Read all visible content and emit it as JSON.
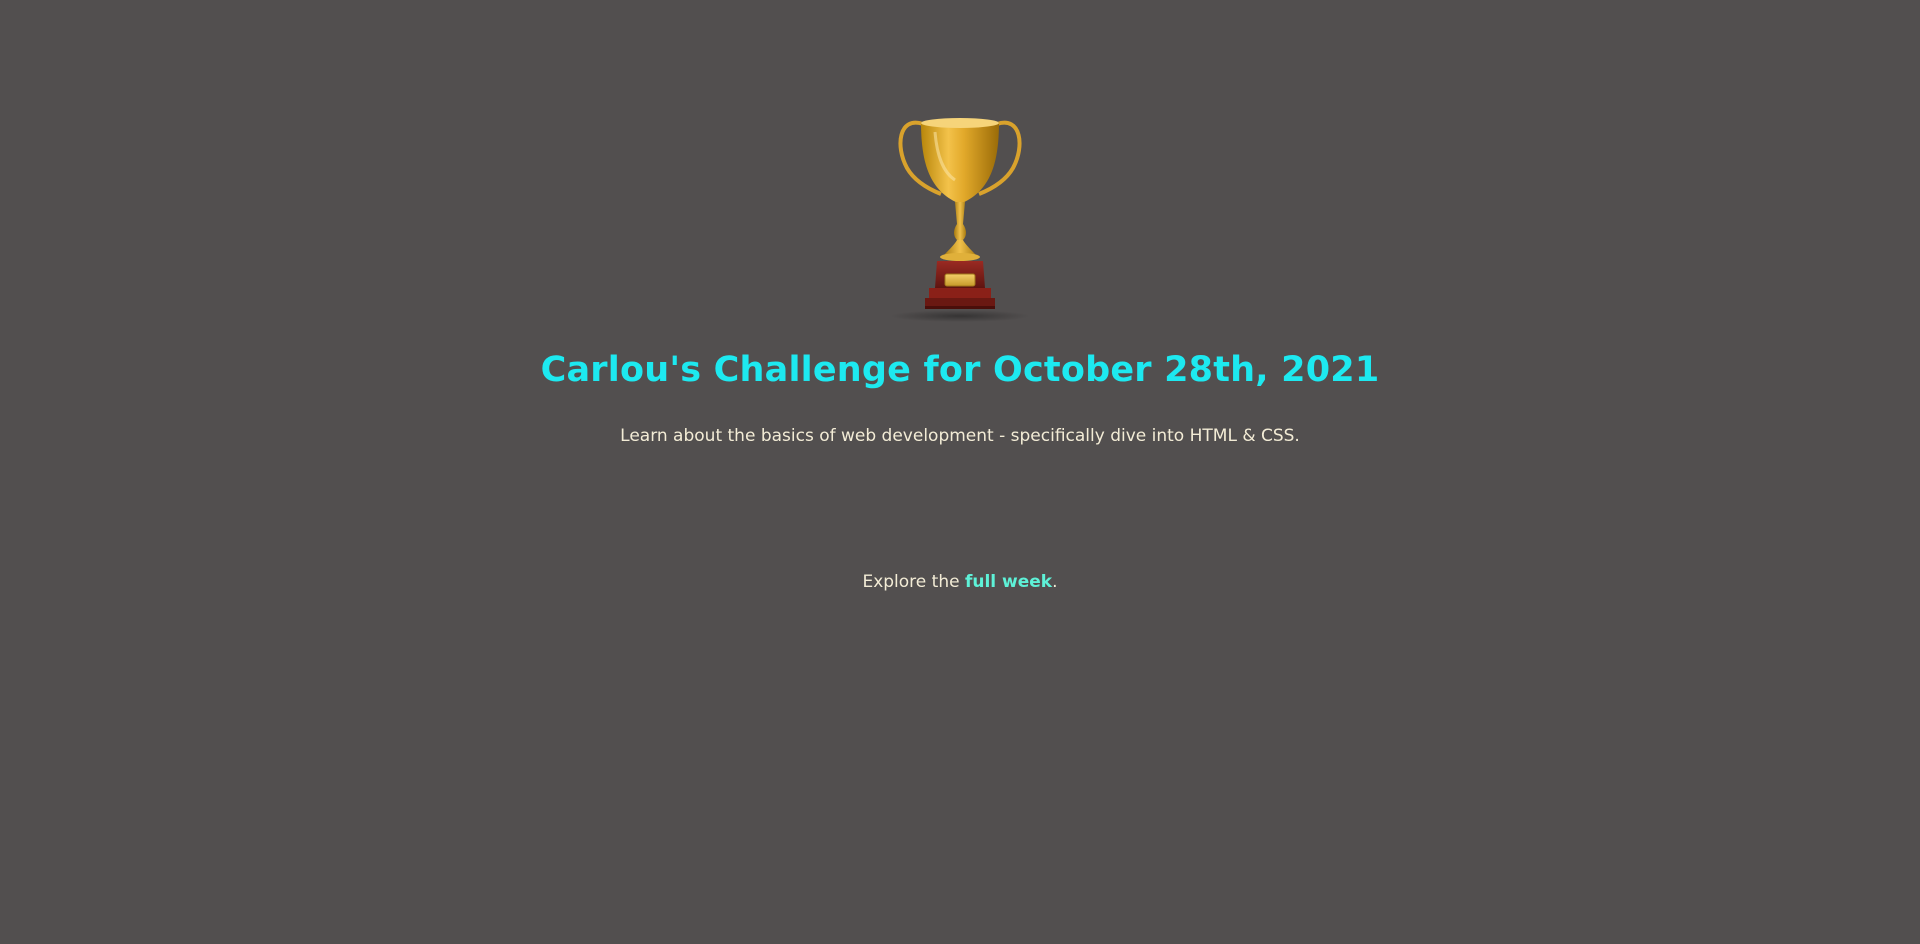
{
  "trophy": {
    "icon": "trophy-icon"
  },
  "main": {
    "title": "Carlou's Challenge for October 28th, 2021",
    "subtitle": "Learn about the basics of web development - specifically dive into HTML & CSS."
  },
  "footer": {
    "explore_prefix": "Explore the ",
    "explore_link": "full week",
    "explore_suffix": "."
  },
  "colors": {
    "background": "#524f4f",
    "title": "#1de9f0",
    "text": "#f3ecd6",
    "link": "#5ef2d8"
  }
}
